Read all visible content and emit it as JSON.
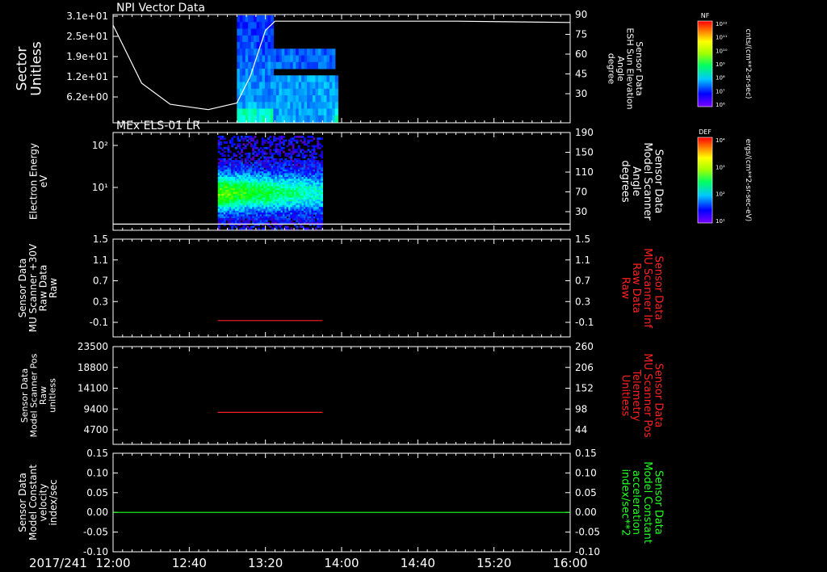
{
  "date_label": "2017/241",
  "x_tick_labels": [
    "12:00",
    "12:40",
    "13:20",
    "14:00",
    "14:40",
    "15:20",
    "16:00"
  ],
  "colorbars": [
    {
      "tag": "NF",
      "unit": "cnts/(cm**2-sr-sec)",
      "tick_labels": [
        "10¹²",
        "10¹¹",
        "10¹⁰",
        "10⁹",
        "10⁸",
        "10⁷",
        "10⁶"
      ]
    },
    {
      "tag": "DEF",
      "unit": "ergs/(cm**2-sr-sec-eV)",
      "tick_labels": [
        "10⁴",
        "10³",
        "10²",
        "10¹"
      ]
    }
  ],
  "panels": [
    {
      "title": "NPI Vector Data",
      "left_label": [
        "Sector",
        "Unitless"
      ],
      "left_ticks": [
        "3.1e+01",
        "2.5e+01",
        "1.9e+01",
        "1.2e+01",
        "6.2e+00"
      ],
      "right_label": [
        "Sensor Data",
        "ESH Sun Elevation",
        "Angle",
        "degree"
      ],
      "right_ticks": [
        "90",
        "75",
        "60",
        "45",
        "30"
      ],
      "right_color": "#ffffff"
    },
    {
      "title": "MEx ELS-01 LR",
      "left_label": [
        "Electron Energy",
        "eV"
      ],
      "left_ticks": [
        "10²",
        "10¹"
      ],
      "right_label": [
        "Sensor Data",
        "Model Scanner",
        "Angle",
        "degrees"
      ],
      "right_ticks": [
        "190",
        "150",
        "110",
        "70",
        "30"
      ],
      "right_color": "#ffffff"
    },
    {
      "title": "",
      "left_label": [
        "Sensor Data",
        "MU Scanner +30V",
        "Raw Data",
        "Raw"
      ],
      "left_ticks": [
        "1.5",
        "1.1",
        "0.7",
        "0.3",
        "-0.1"
      ],
      "right_label": [
        "Sensor Data",
        "MU Scanner Inf",
        "Raw Data",
        "Raw"
      ],
      "right_ticks": [
        "1.5",
        "1.1",
        "0.7",
        "0.3",
        "-0.1"
      ],
      "right_color": "#ff2020"
    },
    {
      "title": "",
      "left_label": [
        "Sensor Data",
        "Model Scanner Pos",
        "Raw",
        "unitless"
      ],
      "left_ticks": [
        "23500",
        "18800",
        "14100",
        "9400",
        "4700"
      ],
      "right_label": [
        "Sensor Data",
        "MU Scanner Pos",
        "Telemetry",
        "Unitless"
      ],
      "right_ticks": [
        "260",
        "206",
        "152",
        "98",
        "44"
      ],
      "right_color": "#ff2020"
    },
    {
      "title": "",
      "left_label": [
        "Sensor Data",
        "Model Constant",
        "velocity",
        "index/sec"
      ],
      "left_ticks": [
        "0.15",
        "0.10",
        "0.05",
        "0.00",
        "-0.05",
        "-0.10"
      ],
      "right_label": [
        "Sensor Data",
        "Model Constant",
        "acceleration",
        "index/sec**2"
      ],
      "right_ticks": [
        "0.15",
        "0.10",
        "0.05",
        "0.00",
        "-0.05",
        "-0.10"
      ],
      "right_color": "#20ff20"
    }
  ],
  "chart_data": [
    {
      "type": "heatmap",
      "title": "NPI Vector Data",
      "ylabel": "Sector Unitless",
      "xlim": [
        "12:00",
        "16:00"
      ],
      "data_time_range": [
        "13:05",
        "13:58"
      ],
      "overlay_line": {
        "name": "Sensor Data ESH Sun Elevation Angle",
        "color": "#ffffff",
        "x": [
          "12:00",
          "12:15",
          "12:30",
          "12:50",
          "13:05",
          "13:12",
          "13:20",
          "13:25",
          "14:00",
          "15:00",
          "16:00"
        ],
        "y": [
          84,
          40,
          24,
          20,
          25,
          45,
          80,
          87,
          87,
          87,
          86
        ]
      }
    },
    {
      "type": "heatmap",
      "title": "MEx ELS-01 LR",
      "ylabel": "Electron Energy eV",
      "xlim": [
        "12:00",
        "16:00"
      ],
      "data_time_range": [
        "12:55",
        "13:50"
      ],
      "overlay_line": {
        "name": "Sensor Data Model Scanner Angle",
        "color": "#ffffff",
        "x": [
          "12:00",
          "16:00"
        ],
        "y": [
          12,
          12
        ]
      }
    },
    {
      "type": "line",
      "xlim": [
        "12:00",
        "16:00"
      ],
      "ylim": [
        -0.3,
        1.5
      ],
      "series": [
        {
          "color": "#ff2020",
          "x": [
            "12:55",
            "13:50"
          ],
          "y": [
            0,
            0
          ]
        }
      ]
    },
    {
      "type": "line",
      "xlim": [
        "12:00",
        "16:00"
      ],
      "ylim": [
        0,
        23500
      ],
      "series": [
        {
          "color": "#ff2020",
          "x": [
            "12:55",
            "13:50"
          ],
          "y": [
            7700,
            7700
          ]
        }
      ]
    },
    {
      "type": "line",
      "xlim": [
        "12:00",
        "16:00"
      ],
      "ylim": [
        -0.1,
        0.15
      ],
      "series": [
        {
          "color": "#20ff20",
          "x": [
            "12:00",
            "16:00"
          ],
          "y": [
            0.0,
            0.0
          ]
        }
      ]
    }
  ]
}
